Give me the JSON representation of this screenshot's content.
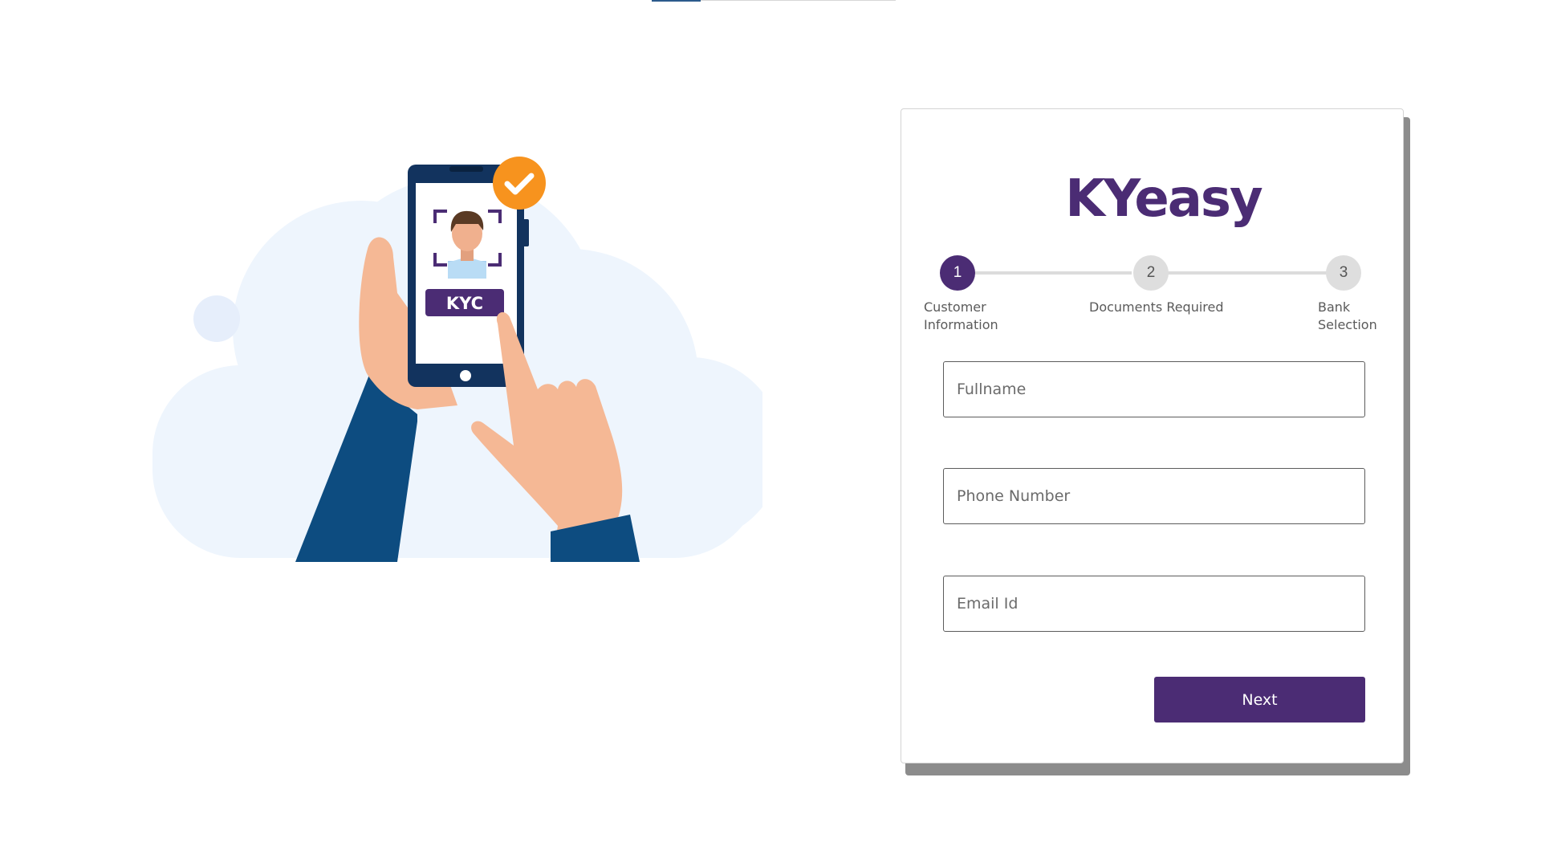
{
  "brand": {
    "name": "KYeasy",
    "color": "#4b2c74"
  },
  "illustration": {
    "badge_text": "KYC",
    "check_color": "#f7931e",
    "sleeve_color": "#0d4c80",
    "skin_color": "#f5b895",
    "cloud_color": "#eef5fd"
  },
  "stepper": {
    "active_step": 1,
    "steps": [
      {
        "number": "1",
        "label_line1": "Customer",
        "label_line2": "Information"
      },
      {
        "number": "2",
        "label_line1": "Documents Required",
        "label_line2": ""
      },
      {
        "number": "3",
        "label_line1": "Bank",
        "label_line2": "Selection"
      }
    ]
  },
  "form": {
    "fullname": {
      "placeholder": "Fullname",
      "value": ""
    },
    "phone": {
      "placeholder": "Phone Number",
      "value": ""
    },
    "email": {
      "placeholder": "Email Id",
      "value": ""
    },
    "next_label": "Next"
  }
}
